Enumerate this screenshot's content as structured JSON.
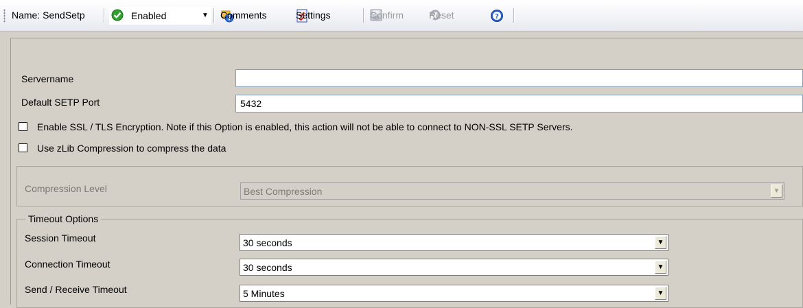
{
  "toolbar": {
    "name_label": "Name: SendSetp",
    "status": {
      "value": "Enabled",
      "icon": "green-check-icon"
    },
    "buttons": [
      {
        "label": "Comments",
        "icon": "comments-info-icon",
        "enabled": true
      },
      {
        "label": "Settings",
        "icon": "settings-checklist-icon",
        "enabled": true
      },
      {
        "label": "Confirm",
        "icon": "save-disk-icon",
        "enabled": false
      },
      {
        "label": "Reset",
        "icon": "reset-icon",
        "enabled": false
      },
      {
        "label": "",
        "icon": "help-icon",
        "enabled": true
      }
    ]
  },
  "form": {
    "servername": {
      "label": "Servername",
      "value": ""
    },
    "port": {
      "label": "Default SETP Port",
      "value": "5432"
    },
    "ssl": {
      "label": "Enable SSL / TLS Encryption. Note if this Option is enabled, this action will not be able to connect to NON-SSL SETP Servers.",
      "checked": false
    },
    "zlib": {
      "label": "Use zLib Compression to compress the data",
      "checked": false
    },
    "compression": {
      "label": "Compression Level",
      "value": "Best Compression",
      "enabled": false
    },
    "timeouts": {
      "legend": "Timeout Options",
      "session": {
        "label": "Session Timeout",
        "value": "30 seconds"
      },
      "connection": {
        "label": "Connection Timeout",
        "value": "30 seconds"
      },
      "send_receive": {
        "label": "Send / Receive Timeout",
        "value": "5 Minutes"
      }
    }
  },
  "colors": {
    "background": "#d4d0c8",
    "toolbar": "#f3f4f8",
    "disabled_text": "#7c7a74",
    "check_green": "#2fa12f",
    "help_blue": "#2c5fd1"
  }
}
